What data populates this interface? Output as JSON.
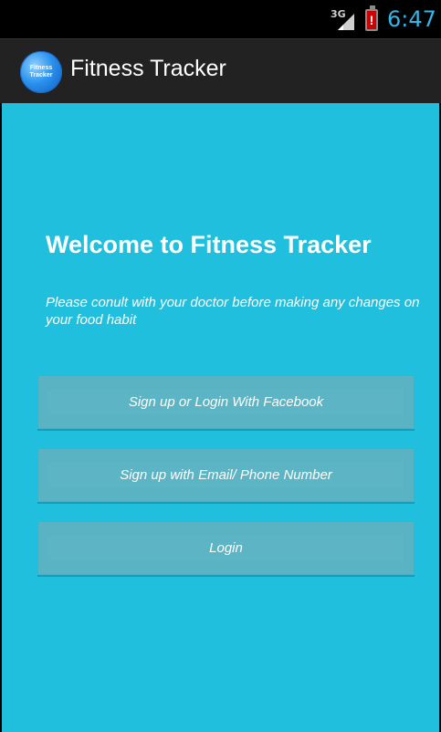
{
  "status_bar": {
    "network_label": "3G",
    "battery_alert": "!",
    "time": "6:47",
    "icons": [
      "signal-icon",
      "battery-alert-icon"
    ]
  },
  "action_bar": {
    "icon_text": "Fitness Tracker",
    "title": "Fitness Tracker"
  },
  "main": {
    "welcome": "Welcome to Fitness Tracker",
    "notice": "Please conult with your doctor before making any changes on your food habit",
    "buttons": {
      "facebook": "Sign up or Login With Facebook",
      "email": "Sign up with Email/ Phone Number",
      "login": "Login"
    }
  },
  "colors": {
    "background": "#20bfde",
    "button": "#5ab3c3",
    "action_bar": "#222222",
    "status_accent": "#33b5e5"
  }
}
